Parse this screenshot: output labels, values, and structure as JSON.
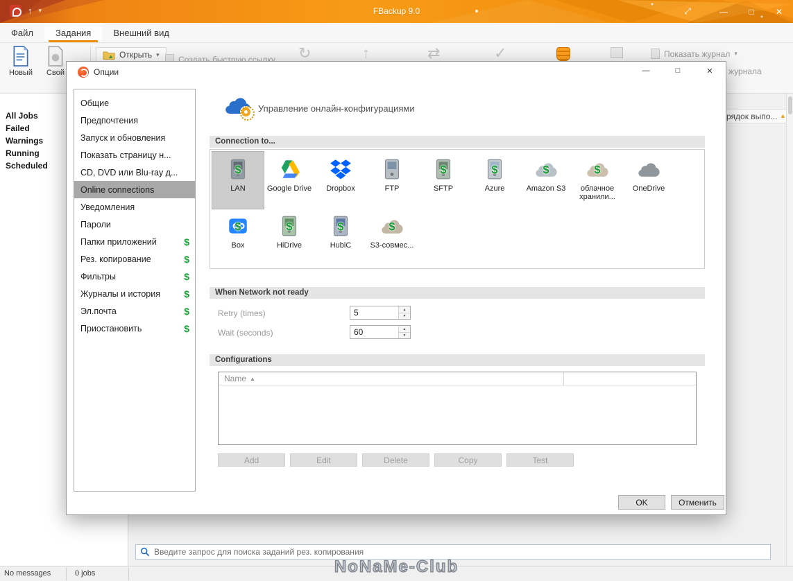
{
  "icons": {
    "caret_down": "▾",
    "up_arrow": "↑",
    "refresh": "↻",
    "sync": "⇄",
    "check": "✓",
    "minimize": "—",
    "maximize": "□",
    "close": "✕",
    "fullscreen": "⤢",
    "sort_asc": "▲",
    "spin_up": "▴",
    "spin_down": "▾",
    "dollar": "$"
  },
  "window": {
    "title": "FBackup 9.0"
  },
  "menu": {
    "tabs": [
      {
        "label": "Файл"
      },
      {
        "label": "Задания"
      },
      {
        "label": "Внешний вид"
      }
    ]
  },
  "ribbon": {
    "new_label": "Новый",
    "properties_label": "Свой",
    "open_label": "Открыть",
    "quick_link_label": "Создать быструю ссылку...",
    "show_log_label": "Показать журнал",
    "log_partial_label": "журнала"
  },
  "jobs_sidebar": {
    "items": [
      {
        "label": "All Jobs"
      },
      {
        "label": "Failed"
      },
      {
        "label": "Warnings"
      },
      {
        "label": "Running"
      },
      {
        "label": "Scheduled"
      }
    ]
  },
  "content": {
    "partial_column_header": "рядок выпо...",
    "search_placeholder": "Введите запрос для поиска заданий рез. копирования"
  },
  "statusbar": {
    "messages": "No messages",
    "jobs": "0 jobs"
  },
  "watermark": "NoNaMe-Club",
  "dialog": {
    "title": "Опции",
    "nav": [
      {
        "label": "Общие"
      },
      {
        "label": "Предпочтения"
      },
      {
        "label": "Запуск и обновления"
      },
      {
        "label": "Показать страницу н..."
      },
      {
        "label": "CD, DVD или Blu-ray д..."
      },
      {
        "label": "Online connections",
        "selected": true
      },
      {
        "label": "Уведомления"
      },
      {
        "label": "Пароли"
      },
      {
        "label": "Папки приложений",
        "paid": true
      },
      {
        "label": "Рез. копирование",
        "paid": true
      },
      {
        "label": "Фильтры",
        "paid": true
      },
      {
        "label": "Журналы и история",
        "paid": true
      },
      {
        "label": "Эл.почта",
        "paid": true
      },
      {
        "label": "Приостановить",
        "paid": true
      }
    ],
    "header_text": "Управление онлайн-конфигурациями",
    "sections": {
      "connection": "Connection to...",
      "network": "When Network not ready",
      "configurations": "Configurations"
    },
    "connections": [
      {
        "label": "LAN",
        "icon": "lan-drive-icon",
        "selected": true
      },
      {
        "label": "Google Drive",
        "icon": "google-drive-icon"
      },
      {
        "label": "Dropbox",
        "icon": "dropbox-icon"
      },
      {
        "label": "FTP",
        "icon": "ftp-drive-icon"
      },
      {
        "label": "SFTP",
        "icon": "sftp-drive-icon"
      },
      {
        "label": "Azure",
        "icon": "azure-icon"
      },
      {
        "label": "Amazon S3",
        "icon": "amazon-s3-icon"
      },
      {
        "label": "облачное хранили...",
        "icon": "cloud-storage-icon"
      },
      {
        "label": "OneDrive",
        "icon": "onedrive-icon"
      },
      {
        "label": "Box",
        "icon": "box-icon"
      },
      {
        "label": "HiDrive",
        "icon": "hidrive-icon"
      },
      {
        "label": "HubiC",
        "icon": "hubic-icon"
      },
      {
        "label": "S3-совмес...",
        "icon": "s3-compatible-icon"
      }
    ],
    "network": {
      "retry_label": "Retry (times)",
      "retry_value": "5",
      "wait_label": "Wait (seconds)",
      "wait_value": "60"
    },
    "table": {
      "name_header": "Name"
    },
    "action_buttons": [
      {
        "label": "Add"
      },
      {
        "label": "Edit"
      },
      {
        "label": "Delete"
      },
      {
        "label": "Copy"
      },
      {
        "label": "Test"
      }
    ],
    "ok_label": "OK",
    "cancel_label": "Отменить"
  },
  "colors": {
    "accent_orange": "#f08c00",
    "paid_green": "#18a037"
  }
}
